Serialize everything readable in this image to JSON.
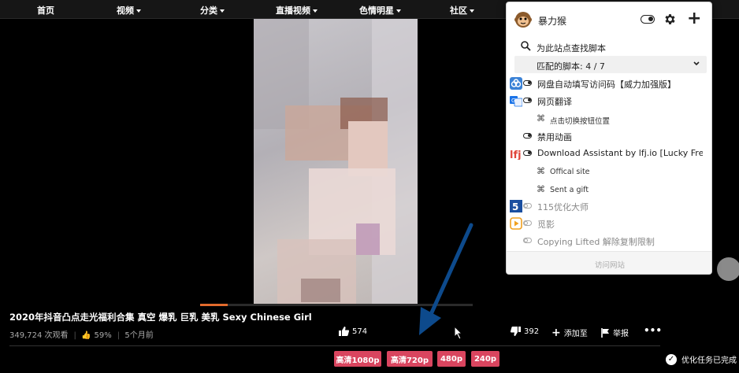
{
  "nav": {
    "items": [
      {
        "label": "首页",
        "dropdown": false
      },
      {
        "label": "视频",
        "dropdown": true
      },
      {
        "label": "分类",
        "dropdown": true
      },
      {
        "label": "直播视频",
        "dropdown": true
      },
      {
        "label": "色情明星",
        "dropdown": true
      },
      {
        "label": "社区",
        "dropdown": true
      }
    ]
  },
  "video": {
    "title": "2020年抖音凸点走光福利合集 真空 爆乳 巨乳 美乳 Sexy Chinese Girl",
    "views": "349,724 次观看",
    "rating": "59%",
    "age": "5个月前",
    "progress_fraction": 0.1,
    "likes": "574",
    "dislikes": "392",
    "add_label": "添加至",
    "report_label": "举报",
    "more_label": "•••"
  },
  "quality_buttons": [
    "高清1080p",
    "高清720p",
    "480p",
    "240p"
  ],
  "toast": {
    "text": "优化任务已完成"
  },
  "popup": {
    "title": "暴力猴",
    "search_text": "为此站点查找脚本",
    "match_text": "匹配的脚本: 4 / 7",
    "visit_text": "访问网站",
    "scripts": [
      {
        "name": "网盘自动填写访问码【威力加强版】",
        "enabled": true,
        "icon": "cloud-drive-icon"
      },
      {
        "name": "网页翻译",
        "enabled": true,
        "icon": "translate-icon"
      },
      {
        "name": "点击切换按钮位置",
        "type": "command"
      },
      {
        "name": "禁用动画",
        "enabled": true,
        "icon": "none"
      },
      {
        "name": "Download Assistant by lfj.io [Lucky Free",
        "enabled": true,
        "icon": "lfj-icon"
      },
      {
        "name": "Offical site",
        "type": "command"
      },
      {
        "name": "Sent a gift",
        "type": "command"
      },
      {
        "name": "115优化大师",
        "enabled": false,
        "icon": "115-icon"
      },
      {
        "name": "觅影",
        "enabled": false,
        "icon": "play-icon"
      },
      {
        "name": "Copying Lifted 解除复制限制",
        "enabled": false,
        "icon": "none"
      }
    ]
  },
  "colors": {
    "accent": "#d9455f",
    "progress": "#e26a2c",
    "arrow": "#0d4a8c"
  }
}
